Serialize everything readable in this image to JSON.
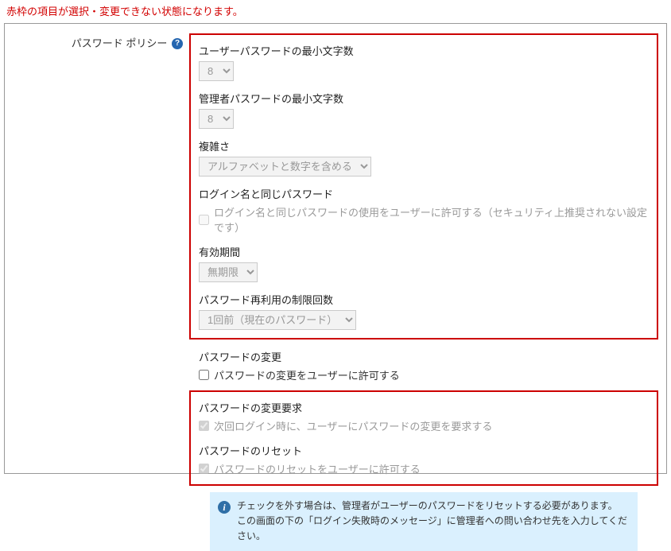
{
  "alert": "赤枠の項目が選択・変更できない状態になります。",
  "section": {
    "label": "パスワード ポリシー"
  },
  "minUser": {
    "label": "ユーザーパスワードの最小文字数",
    "value": "8"
  },
  "minAdmin": {
    "label": "管理者パスワードの最小文字数",
    "value": "8"
  },
  "complexity": {
    "label": "複雑さ",
    "value": "アルファベットと数字を含める"
  },
  "sameAsLogin": {
    "label": "ログイン名と同じパスワード",
    "cbLabel": "ログイン名と同じパスワードの使用をユーザーに許可する（セキュリティ上推奨されない設定です）"
  },
  "expiry": {
    "label": "有効期間",
    "value": "無期限"
  },
  "reuse": {
    "label": "パスワード再利用の制限回数",
    "value": "1回前（現在のパスワード）"
  },
  "pwChange": {
    "label": "パスワードの変更",
    "cbLabel": "パスワードの変更をユーザーに許可する"
  },
  "pwChangeReq": {
    "label": "パスワードの変更要求",
    "cbLabel": "次回ログイン時に、ユーザーにパスワードの変更を要求する"
  },
  "pwReset": {
    "label": "パスワードのリセット",
    "cbLabel": "パスワードのリセットをユーザーに許可する"
  },
  "info": {
    "line1": "チェックを外す場合は、管理者がユーザーのパスワードをリセットする必要があります。",
    "line2": "この画面の下の「ログイン失敗時のメッセージ」に管理者への問い合わせ先を入力してください。"
  }
}
